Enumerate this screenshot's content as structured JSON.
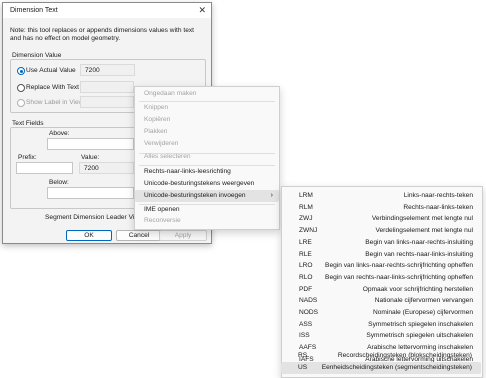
{
  "dialog": {
    "title": "Dimension Text",
    "note": "Note: this tool replaces or appends dimensions values with text and has no effect on model geometry.",
    "dimension_value": {
      "group_label": "Dimension Value",
      "use_actual_value_label": "Use Actual Value",
      "actual_value": "7200",
      "replace_with_text_label": "Replace With Text",
      "show_label_in_view_label": "Show Label in View"
    },
    "text_fields": {
      "group_label": "Text Fields",
      "above_label": "Above:",
      "prefix_label": "Prefix:",
      "value_label": "Value:",
      "value": "7200",
      "below_label": "Below:"
    },
    "segment_leader_label": "Segment Dimension Leader Visibility:",
    "buttons": {
      "ok": "OK",
      "cancel": "Cancel",
      "apply": "Apply"
    }
  },
  "context_menu": {
    "items": [
      {
        "label": "Ongedaan maken",
        "disabled": true
      },
      {
        "label": "Knippen",
        "disabled": true
      },
      {
        "label": "Kopiëren",
        "disabled": true
      },
      {
        "label": "Plakken",
        "disabled": true
      },
      {
        "label": "Verwijderen",
        "disabled": true
      },
      {
        "label": "Alles selecteren",
        "disabled": true
      },
      {
        "label": "Rechts-naar-links-leesrichting",
        "disabled": false
      },
      {
        "label": "Unicode-besturingstekens weergeven",
        "disabled": false
      },
      {
        "label": "Unicode-besturingsteken invoegen",
        "disabled": false,
        "submenu": true
      },
      {
        "label": "IME openen",
        "disabled": false
      },
      {
        "label": "Reconversie",
        "disabled": true
      }
    ],
    "submenu_arrow": "›"
  },
  "submenu": {
    "items": [
      {
        "code": "LRM",
        "desc": "Links-naar-rechts-teken"
      },
      {
        "code": "RLM",
        "desc": "Rechts-naar-links-teken"
      },
      {
        "code": "ZWJ",
        "desc": "Verbindingselement met lengte nul"
      },
      {
        "code": "ZWNJ",
        "desc": "Verdelingselement met lengte nul"
      },
      {
        "code": "LRE",
        "desc": "Begin van links-naar-rechts-insluiting"
      },
      {
        "code": "RLE",
        "desc": "Begin van rechts-naar-links-insluiting"
      },
      {
        "code": "LRO",
        "desc": "Begin van links-naar-rechts-schrijfrichting opheffen"
      },
      {
        "code": "RLO",
        "desc": "Begin van rechts-naar-links-schrijfrichting opheffen"
      },
      {
        "code": "PDF",
        "desc": "Opmaak voor schrijfrichting herstellen"
      },
      {
        "code": "NADS",
        "desc": "Nationale cijfervormen vervangen"
      },
      {
        "code": "NODS",
        "desc": "Nominale (Europese) cijfervormen"
      },
      {
        "code": "ASS",
        "desc": "Symmetrisch spiegelen inschakelen"
      },
      {
        "code": "ISS",
        "desc": "Symmetrisch spiegelen uitschakelen"
      },
      {
        "code": "AAFS",
        "desc": "Arabische lettervorming inschakelen"
      },
      {
        "code": "IAFS",
        "desc": "Arabische lettervorming uitschakelen"
      },
      {
        "code": "RS",
        "desc": "Recordscheidingsteken (blokscheidingsteken)"
      },
      {
        "code": "US",
        "desc": "Eenheidscheidingsteken (segmentscheidingsteken)"
      }
    ]
  }
}
